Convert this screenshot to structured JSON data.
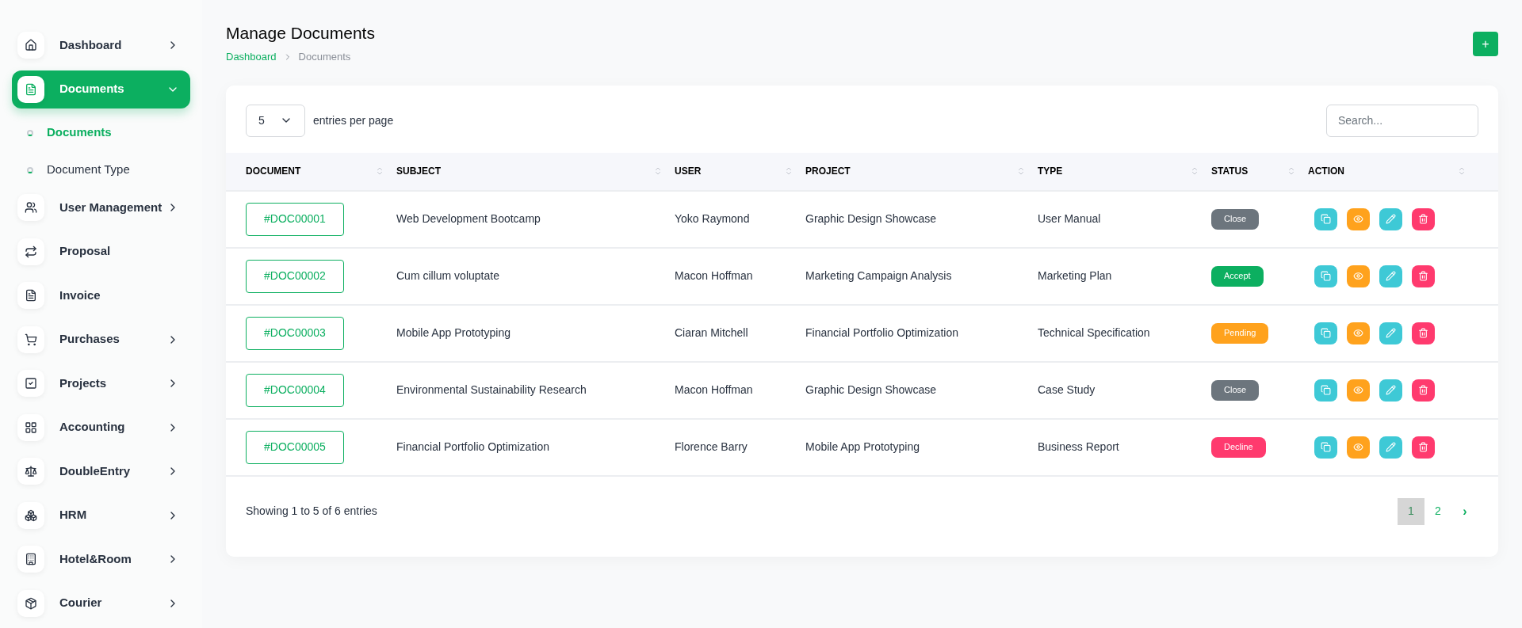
{
  "sidebar": {
    "items": [
      {
        "label": "Dashboard",
        "kind": "group",
        "selected": false,
        "expanded": false
      },
      {
        "label": "Documents",
        "kind": "group",
        "selected": true,
        "expanded": true,
        "children": [
          {
            "label": "Documents",
            "selected": true
          },
          {
            "label": "Document Type",
            "selected": false
          }
        ]
      },
      {
        "label": "User Management",
        "kind": "group",
        "selected": false,
        "expanded": false
      },
      {
        "label": "Proposal",
        "kind": "link",
        "selected": false
      },
      {
        "label": "Invoice",
        "kind": "link",
        "selected": false
      },
      {
        "label": "Purchases",
        "kind": "group",
        "selected": false,
        "expanded": false
      },
      {
        "label": "Projects",
        "kind": "group",
        "selected": false,
        "expanded": false
      },
      {
        "label": "Accounting",
        "kind": "group",
        "selected": false,
        "expanded": false
      },
      {
        "label": "DoubleEntry",
        "kind": "group",
        "selected": false,
        "expanded": false
      },
      {
        "label": "HRM",
        "kind": "group",
        "selected": false,
        "expanded": false
      },
      {
        "label": "Hotel&Room",
        "kind": "group",
        "selected": false,
        "expanded": false
      },
      {
        "label": "Courier",
        "kind": "group",
        "selected": false,
        "expanded": false
      }
    ]
  },
  "header": {
    "title": "Manage Documents",
    "breadcrumb": [
      "Dashboard",
      "Documents"
    ],
    "add_button": "+"
  },
  "table": {
    "page_size": "5",
    "page_size_label": "entries per page",
    "search": {
      "placeholder": "Search..."
    },
    "columns": [
      "DOCUMENT",
      "SUBJECT",
      "USER",
      "PROJECT",
      "TYPE",
      "STATUS",
      "ACTION"
    ],
    "rows": [
      {
        "document": "#DOC00001",
        "subject": "Web Development Bootcamp",
        "user": "Yoko Raymond",
        "project": "Graphic Design Showcase",
        "type": "User Manual",
        "status": "Close",
        "color": "#6c757d"
      },
      {
        "document": "#DOC00002",
        "subject": "Cum cillum voluptate",
        "user": "Macon Hoffman",
        "project": "Marketing Campaign Analysis",
        "type": "Marketing Plan",
        "status": "Accept",
        "color": "#0caf60"
      },
      {
        "document": "#DOC00003",
        "subject": "Mobile App Prototyping",
        "user": "Ciaran Mitchell",
        "project": "Financial Portfolio Optimization",
        "type": "Technical Specification",
        "status": "Pending",
        "color": "#ffa21d"
      },
      {
        "document": "#DOC00004",
        "subject": "Environmental Sustainability Research",
        "user": "Macon Hoffman",
        "project": "Graphic Design Showcase",
        "type": "Case Study",
        "status": "Close",
        "color": "#6c757d"
      },
      {
        "document": "#DOC00005",
        "subject": "Financial Portfolio Optimization",
        "user": "Florence Barry",
        "project": "Mobile App Prototyping",
        "type": "Business Report",
        "status": "Decline",
        "color": "#ff3a6e"
      }
    ],
    "summary": "Showing 1 to 5 of 6 entries",
    "pages": [
      {
        "label": "1",
        "selected": true
      },
      {
        "label": "2",
        "selected": false
      }
    ],
    "next": "›"
  }
}
